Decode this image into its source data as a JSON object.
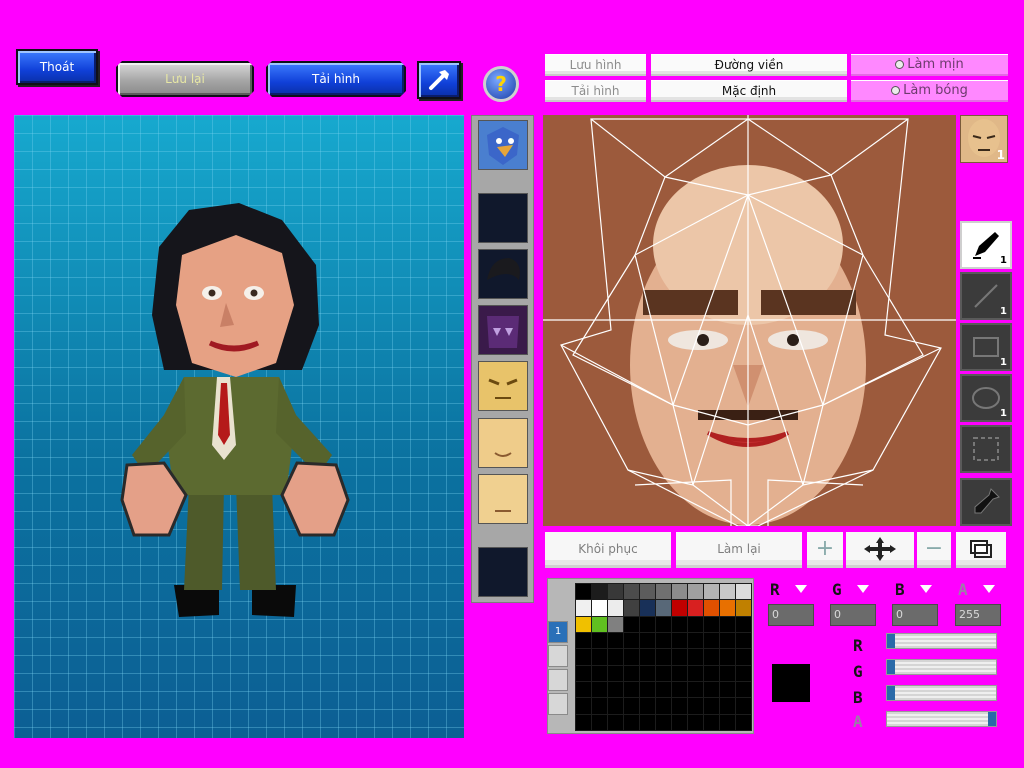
{
  "toolbar_left": {
    "exit_label": "Thoát",
    "save_label": "Lưu lại",
    "load_label": "Tải hình"
  },
  "toolbar_right": {
    "save_image_label": "Lưu hình",
    "load_image_label": "Tải hình",
    "outline_label": "Đường viền",
    "default_label": "Mặc định",
    "smooth_label": "Làm mịn",
    "shade_label": "Làm bóng"
  },
  "actions": {
    "restore_label": "Khôi phục",
    "redo_label": "Làm lại"
  },
  "tools": {
    "pen_size": "1",
    "line_size": "1",
    "rect_size": "1",
    "ellipse_size": "1",
    "part_badge": "1"
  },
  "color": {
    "r_value": "0",
    "g_value": "0",
    "b_value": "0",
    "a_value": "255",
    "r_label": "R",
    "g_label": "G",
    "b_label": "B",
    "a_label": "A",
    "current": "#000000",
    "slider_r": 0,
    "slider_g": 0,
    "slider_b": 0,
    "slider_a": 1
  },
  "palette": {
    "tab_label": "1",
    "colors": [
      "#000000",
      "#1c1c1c",
      "#383838",
      "#4c4c4c",
      "#5c5c5c",
      "#707070",
      "#8c8c8c",
      "#a0a0a0",
      "#b4b4b4",
      "#c8c8c8",
      "#dcdcdc",
      "#f0f0f0",
      "#ffffff",
      "#ececec",
      "#404040",
      "#183058",
      "#586878",
      "#c00000",
      "#d82020",
      "#e05000",
      "#e87000",
      "#c08000",
      "#f0c000",
      "#60c020",
      "#808080"
    ]
  },
  "icons": [
    "help-icon",
    "hammer-icon",
    "pen-icon",
    "line-icon",
    "rect-icon",
    "ellipse-icon",
    "select-icon",
    "eyedropper-icon",
    "move-icon",
    "plus-icon",
    "minus-icon",
    "layer-icon"
  ]
}
